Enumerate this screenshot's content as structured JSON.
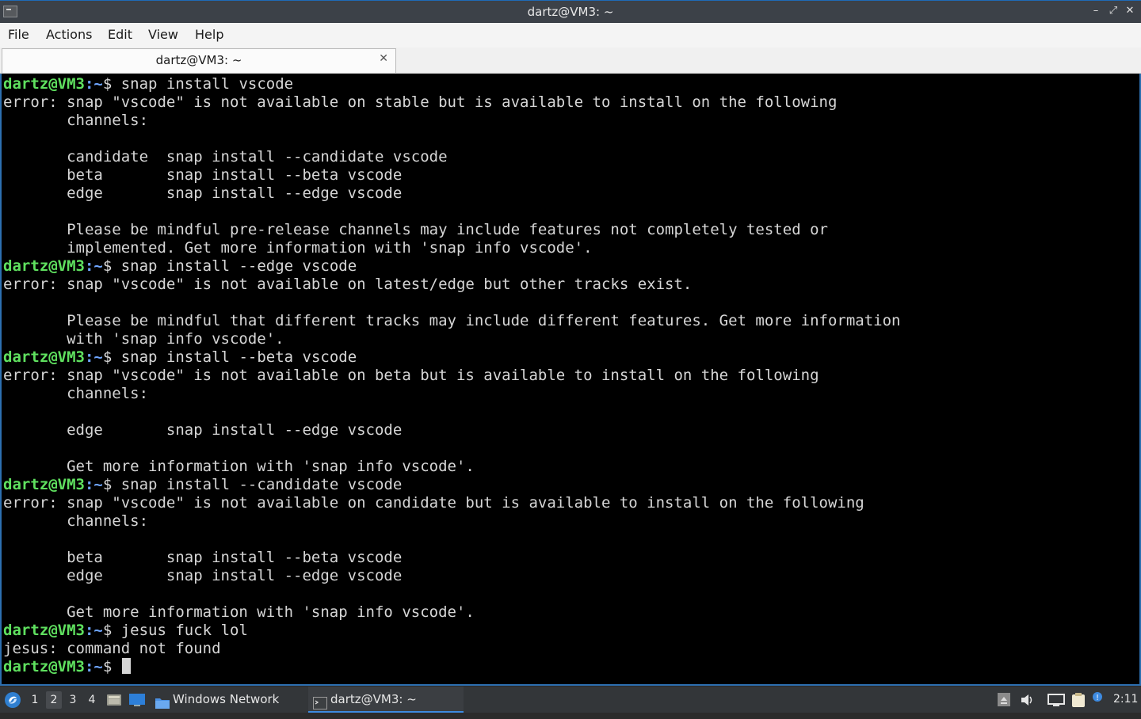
{
  "window": {
    "title": "dartz@VM3: ~"
  },
  "menu": [
    "File",
    "Actions",
    "Edit",
    "View",
    "Help"
  ],
  "tab": {
    "label": "dartz@VM3: ~",
    "close": "✕"
  },
  "terminal": {
    "prompt_user": "dartz@VM3",
    "prompt_path": ":~",
    "prompt_symbol": "$",
    "lines": [
      {
        "type": "cmd",
        "text": " snap install vscode"
      },
      {
        "type": "out",
        "text": "error: snap \"vscode\" is not available on stable but is available to install on the following"
      },
      {
        "type": "out",
        "text": "       channels:"
      },
      {
        "type": "out",
        "text": ""
      },
      {
        "type": "out",
        "text": "       candidate  snap install --candidate vscode"
      },
      {
        "type": "out",
        "text": "       beta       snap install --beta vscode"
      },
      {
        "type": "out",
        "text": "       edge       snap install --edge vscode"
      },
      {
        "type": "out",
        "text": ""
      },
      {
        "type": "out",
        "text": "       Please be mindful pre-release channels may include features not completely tested or"
      },
      {
        "type": "out",
        "text": "       implemented. Get more information with 'snap info vscode'."
      },
      {
        "type": "cmd",
        "text": " snap install --edge vscode"
      },
      {
        "type": "out",
        "text": "error: snap \"vscode\" is not available on latest/edge but other tracks exist."
      },
      {
        "type": "out",
        "text": ""
      },
      {
        "type": "out",
        "text": "       Please be mindful that different tracks may include different features. Get more information"
      },
      {
        "type": "out",
        "text": "       with 'snap info vscode'."
      },
      {
        "type": "cmd",
        "text": " snap install --beta vscode"
      },
      {
        "type": "out",
        "text": "error: snap \"vscode\" is not available on beta but is available to install on the following"
      },
      {
        "type": "out",
        "text": "       channels:"
      },
      {
        "type": "out",
        "text": ""
      },
      {
        "type": "out",
        "text": "       edge       snap install --edge vscode"
      },
      {
        "type": "out",
        "text": ""
      },
      {
        "type": "out",
        "text": "       Get more information with 'snap info vscode'."
      },
      {
        "type": "cmd",
        "text": " snap install --candidate vscode"
      },
      {
        "type": "out",
        "text": "error: snap \"vscode\" is not available on candidate but is available to install on the following"
      },
      {
        "type": "out",
        "text": "       channels:"
      },
      {
        "type": "out",
        "text": ""
      },
      {
        "type": "out",
        "text": "       beta       snap install --beta vscode"
      },
      {
        "type": "out",
        "text": "       edge       snap install --edge vscode"
      },
      {
        "type": "out",
        "text": ""
      },
      {
        "type": "out",
        "text": "       Get more information with 'snap info vscode'."
      },
      {
        "type": "cmd",
        "text": " jesus fuck lol"
      },
      {
        "type": "out",
        "text": "jesus: command not found"
      },
      {
        "type": "cmd",
        "text": " ",
        "cursor": true
      }
    ]
  },
  "taskbar": {
    "workspaces": [
      "1",
      "2",
      "3",
      "4"
    ],
    "active_workspace": "2",
    "tasks": [
      {
        "label": "Windows Network",
        "icon": "folder-icon"
      },
      {
        "label": "dartz@VM3: ~",
        "icon": "terminal-icon",
        "active": true
      }
    ],
    "clock": "2:11"
  },
  "colors": {
    "prompt_user": "#5fe05f",
    "prompt_path": "#6ea5ff",
    "accent": "#2d6fb0"
  }
}
